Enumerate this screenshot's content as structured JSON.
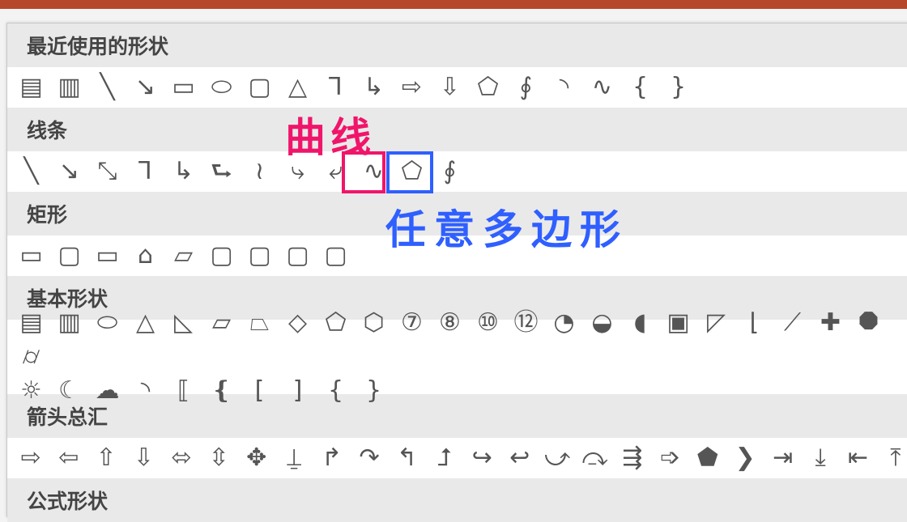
{
  "colors": {
    "title_bar": "#b7472a",
    "curve_highlight": "#f0156a",
    "freeform_highlight": "#2f5fff"
  },
  "annotations": {
    "curve": "曲线",
    "freeform": "任意多边形"
  },
  "sections": [
    {
      "title": "最近使用的形状",
      "rows": [
        [
          "textbox",
          "vertical-textbox",
          "line",
          "arrow",
          "rectangle",
          "oval",
          "rounded-rectangle",
          "triangle",
          "elbow-connector",
          "elbow-arrow",
          "right-arrow",
          "down-arrow",
          "freeform",
          "scribble",
          "arc",
          "curve",
          "left-brace",
          "right-brace"
        ]
      ]
    },
    {
      "title": "线条",
      "rows": [
        [
          "line",
          "arrow",
          "double-arrow",
          "elbow-connector",
          "elbow-arrow",
          "elbow-double-arrow",
          "curved-connector",
          "curved-arrow",
          "curved-double-arrow",
          "curve",
          "freeform",
          "scribble"
        ]
      ]
    },
    {
      "title": "矩形",
      "rows": [
        [
          "rectangle",
          "rounded-rectangle",
          "snip-corner",
          "snip-same-side",
          "snip-diagonal",
          "round-snip",
          "round-corner",
          "round-same-side",
          "round-diagonal"
        ]
      ]
    },
    {
      "title": "基本形状",
      "rows": [
        [
          "textbox",
          "vertical-textbox",
          "oval",
          "triangle",
          "right-triangle",
          "parallelogram",
          "trapezoid",
          "diamond",
          "pentagon",
          "hexagon",
          "heptagon-7",
          "octagon-8",
          "decagon-10",
          "dodecagon-12",
          "pie",
          "chord",
          "teardrop",
          "frame",
          "half-frame",
          "l-shape",
          "diagonal-stripe",
          "cross",
          "plaque",
          "can"
        ],
        [
          "sun",
          "moon",
          "cloud",
          "arc",
          "double-bracket",
          "double-brace",
          "left-bracket",
          "right-bracket",
          "left-brace",
          "right-brace"
        ]
      ]
    },
    {
      "title": "箭头总汇",
      "rows": [
        [
          "right-arrow",
          "left-arrow",
          "up-arrow",
          "down-arrow",
          "left-right-arrow",
          "up-down-arrow",
          "quad-arrow",
          "left-right-up-arrow",
          "bent-arrow",
          "u-turn-arrow",
          "left-up-arrow",
          "bent-up-arrow",
          "curved-right-arrow",
          "curved-left-arrow",
          "curved-up-arrow",
          "curved-down-arrow",
          "striped-right-arrow",
          "notched-right-arrow",
          "pentagon-arrow",
          "chevron",
          "right-arrow-callout",
          "down-arrow-callout",
          "left-arrow-callout",
          "up-arrow-callout"
        ]
      ]
    },
    {
      "title": "公式形状",
      "rows": []
    }
  ]
}
